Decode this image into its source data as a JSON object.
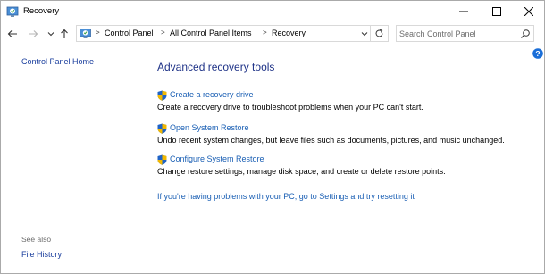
{
  "window": {
    "title": "Recovery",
    "title_icon": "recovery-icon"
  },
  "controls": {
    "minimize": "minimize-icon",
    "maximize": "maximize-icon",
    "close": "close-icon"
  },
  "address": {
    "crumbs": [
      "Control Panel",
      "All Control Panel Items",
      "Recovery"
    ],
    "separator": ">"
  },
  "search": {
    "placeholder": "Search Control Panel"
  },
  "left": {
    "home": "Control Panel Home",
    "see_also": "See also",
    "file_history": "File History"
  },
  "main": {
    "title": "Advanced recovery tools",
    "tasks": [
      {
        "label": "Create a recovery drive",
        "desc": "Create a recovery drive to troubleshoot problems when your PC can't start."
      },
      {
        "label": "Open System Restore",
        "desc": "Undo recent system changes, but leave files such as documents, pictures, and music unchanged."
      },
      {
        "label": "Configure System Restore",
        "desc": "Change restore settings, manage disk space, and create or delete restore points."
      }
    ],
    "reset_link": "If you're having problems with your PC, go to Settings and try resetting it"
  },
  "colors": {
    "link": "#1a5fb4",
    "heading": "#1e3287",
    "nav_link": "#1a3e9d"
  }
}
